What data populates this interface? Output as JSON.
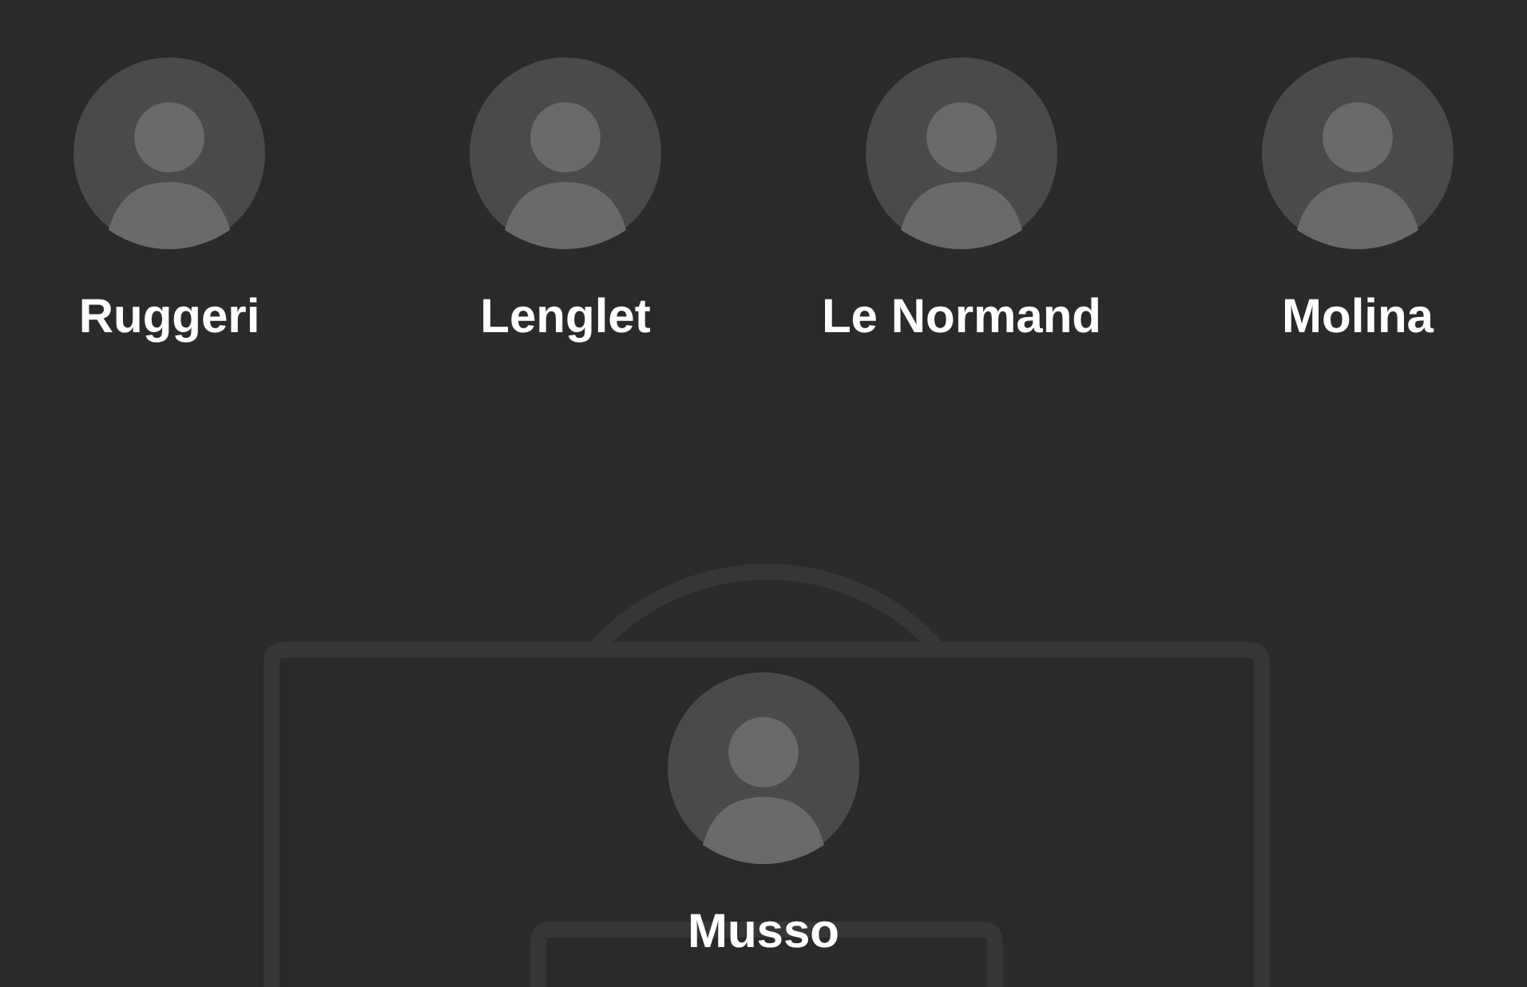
{
  "defenders": [
    {
      "name": "Ruggeri"
    },
    {
      "name": "Lenglet"
    },
    {
      "name": "Le Normand"
    },
    {
      "name": "Molina"
    }
  ],
  "goalkeeper": {
    "name": "Musso"
  }
}
